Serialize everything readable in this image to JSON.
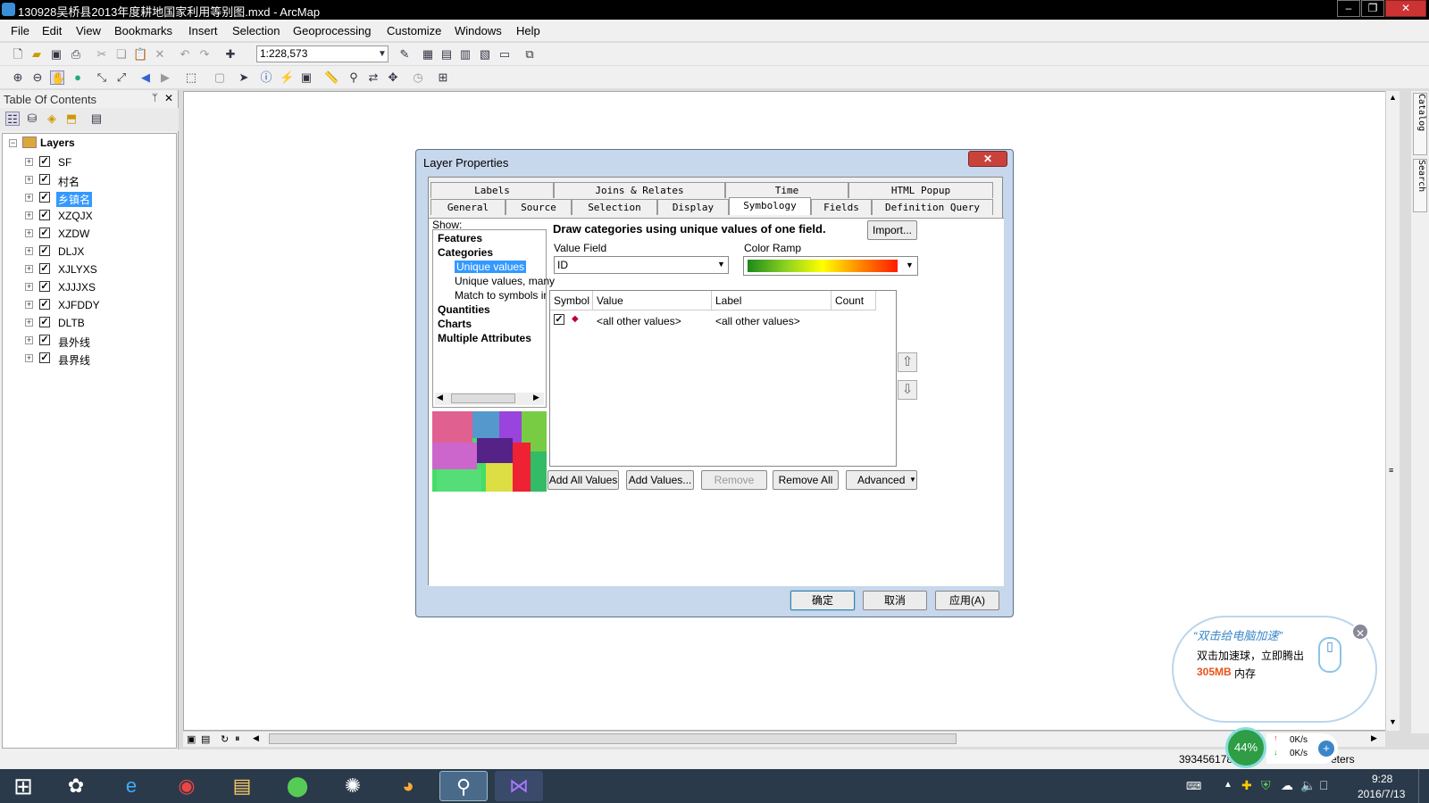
{
  "window": {
    "title": "130928吴桥县2013年度耕地国家利用等别图.mxd - ArcMap",
    "min": "‒",
    "max": "❐",
    "close": "✕"
  },
  "menubar": [
    "File",
    "Edit",
    "View",
    "Bookmarks",
    "Insert",
    "Selection",
    "Geoprocessing",
    "Customize",
    "Windows",
    "Help"
  ],
  "toolbar": {
    "scale": "1:228,573"
  },
  "toc": {
    "title": "Table Of Contents",
    "pin": "ᛘ",
    "close": "✕",
    "root": "Layers",
    "layers": [
      "SF",
      "村名",
      "乡镇名",
      "XZQJX",
      "XZDW",
      "DLJX",
      "XJLYXS",
      "XJJJXS",
      "XJFDDY",
      "DLTB",
      "县外线",
      "县界线"
    ]
  },
  "right_tabs": [
    "Catalog",
    "Search"
  ],
  "dialog": {
    "title": "Layer Properties",
    "close": "✕",
    "tabs_row1": [
      "Labels",
      "Joins & Relates",
      "Time",
      "HTML Popup"
    ],
    "tabs_row2": [
      "General",
      "Source",
      "Selection",
      "Display",
      "Symbology",
      "Fields",
      "Definition Query"
    ],
    "show_label": "Show:",
    "show": {
      "features": "Features",
      "categories": "Categories",
      "unique": "Unique values",
      "unique_many": "Unique values, many",
      "match": "Match to symbols in a",
      "quantities": "Quantities",
      "charts": "Charts",
      "multiple": "Multiple Attributes"
    },
    "heading": "Draw categories using unique values of one field.",
    "import": "Import...",
    "value_field_label": "Value Field",
    "value_field": "ID",
    "color_ramp_label": "Color Ramp",
    "table_headers": [
      "Symbol",
      "Value",
      "Label",
      "Count"
    ],
    "row": {
      "value": "<all other values>",
      "label": "<all other values>",
      "count": ""
    },
    "buttons": [
      "Add All Values",
      "Add Values...",
      "Remove",
      "Remove All",
      "Advanced"
    ],
    "ok": "确定",
    "cancel": "取消",
    "apply": "应用(A)"
  },
  "status": {
    "coords": "393456178",
    "units": "eters"
  },
  "balloon": {
    "title": "“双击给电脑加速”",
    "line1": "双击加速球，立即腾出",
    "mb": "305MB",
    "line2": "内存",
    "percent": "44%",
    "up": "0K/s",
    "down": "0K/s",
    "close": "✕"
  },
  "taskbar": {
    "time": "9:28",
    "date": "2016/7/13"
  }
}
